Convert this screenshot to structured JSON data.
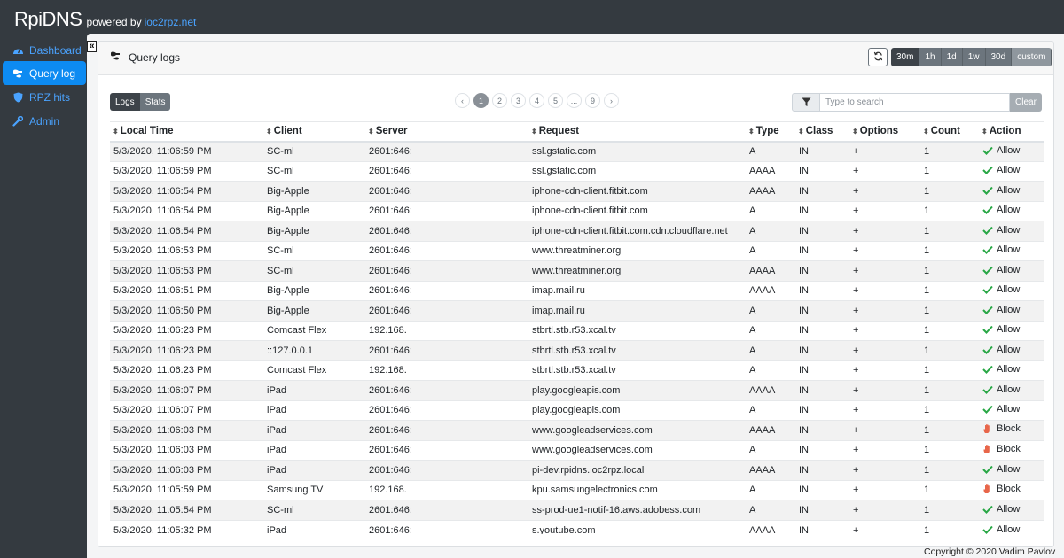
{
  "brand": {
    "name": "RpiDNS",
    "powered_by": "powered by",
    "link_text": "ioc2rpz.net"
  },
  "sidebar": {
    "collapse_label": "«",
    "items": [
      {
        "label": "Dashboard",
        "icon": "dashboard-icon"
      },
      {
        "label": "Query log",
        "icon": "query-log-icon"
      },
      {
        "label": "RPZ hits",
        "icon": "shield-icon"
      },
      {
        "label": "Admin",
        "icon": "wrench-icon"
      }
    ]
  },
  "card": {
    "title": "Query logs"
  },
  "time_range": {
    "options": [
      "30m",
      "1h",
      "1d",
      "1w",
      "30d",
      "custom"
    ],
    "selected": "30m"
  },
  "tabs": {
    "items": [
      "Logs",
      "Stats"
    ],
    "selected": "Logs"
  },
  "pager": {
    "prev": "‹",
    "pages": [
      "1",
      "2",
      "3",
      "4",
      "5",
      "...",
      "9"
    ],
    "next": "›",
    "current": "1"
  },
  "filter": {
    "placeholder": "Type to search",
    "value": "",
    "clear_label": "Clear"
  },
  "table": {
    "columns": [
      "Local Time",
      "Client",
      "Server",
      "Request",
      "Type",
      "Class",
      "Options",
      "Count",
      "Action"
    ],
    "rows": [
      [
        "5/3/2020, 11:06:59 PM",
        "SC-ml",
        "2601:646:",
        "ssl.gstatic.com",
        "A",
        "IN",
        "+",
        "1",
        "Allow"
      ],
      [
        "5/3/2020, 11:06:59 PM",
        "SC-ml",
        "2601:646:",
        "ssl.gstatic.com",
        "AAAA",
        "IN",
        "+",
        "1",
        "Allow"
      ],
      [
        "5/3/2020, 11:06:54 PM",
        "Big-Apple",
        "2601:646:",
        "iphone-cdn-client.fitbit.com",
        "AAAA",
        "IN",
        "+",
        "1",
        "Allow"
      ],
      [
        "5/3/2020, 11:06:54 PM",
        "Big-Apple",
        "2601:646:",
        "iphone-cdn-client.fitbit.com",
        "A",
        "IN",
        "+",
        "1",
        "Allow"
      ],
      [
        "5/3/2020, 11:06:54 PM",
        "Big-Apple",
        "2601:646:",
        "iphone-cdn-client.fitbit.com.cdn.cloudflare.net",
        "A",
        "IN",
        "+",
        "1",
        "Allow"
      ],
      [
        "5/3/2020, 11:06:53 PM",
        "SC-ml",
        "2601:646:",
        "www.threatminer.org",
        "A",
        "IN",
        "+",
        "1",
        "Allow"
      ],
      [
        "5/3/2020, 11:06:53 PM",
        "SC-ml",
        "2601:646:",
        "www.threatminer.org",
        "AAAA",
        "IN",
        "+",
        "1",
        "Allow"
      ],
      [
        "5/3/2020, 11:06:51 PM",
        "Big-Apple",
        "2601:646:",
        "imap.mail.ru",
        "AAAA",
        "IN",
        "+",
        "1",
        "Allow"
      ],
      [
        "5/3/2020, 11:06:50 PM",
        "Big-Apple",
        "2601:646:",
        "imap.mail.ru",
        "A",
        "IN",
        "+",
        "1",
        "Allow"
      ],
      [
        "5/3/2020, 11:06:23 PM",
        "Comcast Flex",
        "192.168.",
        "stbrtl.stb.r53.xcal.tv",
        "A",
        "IN",
        "+",
        "1",
        "Allow"
      ],
      [
        "5/3/2020, 11:06:23 PM",
        "::127.0.0.1",
        "2601:646:",
        "stbrtl.stb.r53.xcal.tv",
        "A",
        "IN",
        "+",
        "1",
        "Allow"
      ],
      [
        "5/3/2020, 11:06:23 PM",
        "Comcast Flex",
        "192.168.",
        "stbrtl.stb.r53.xcal.tv",
        "A",
        "IN",
        "+",
        "1",
        "Allow"
      ],
      [
        "5/3/2020, 11:06:07 PM",
        "iPad",
        "2601:646:",
        "play.googleapis.com",
        "AAAA",
        "IN",
        "+",
        "1",
        "Allow"
      ],
      [
        "5/3/2020, 11:06:07 PM",
        "iPad",
        "2601:646:",
        "play.googleapis.com",
        "A",
        "IN",
        "+",
        "1",
        "Allow"
      ],
      [
        "5/3/2020, 11:06:03 PM",
        "iPad",
        "2601:646:",
        "www.googleadservices.com",
        "AAAA",
        "IN",
        "+",
        "1",
        "Block"
      ],
      [
        "5/3/2020, 11:06:03 PM",
        "iPad",
        "2601:646:",
        "www.googleadservices.com",
        "A",
        "IN",
        "+",
        "1",
        "Block"
      ],
      [
        "5/3/2020, 11:06:03 PM",
        "iPad",
        "2601:646:",
        "pi-dev.rpidns.ioc2rpz.local",
        "AAAA",
        "IN",
        "+",
        "1",
        "Allow"
      ],
      [
        "5/3/2020, 11:05:59 PM",
        "Samsung TV",
        "192.168.",
        "kpu.samsungelectronics.com",
        "A",
        "IN",
        "+",
        "1",
        "Block"
      ],
      [
        "5/3/2020, 11:05:54 PM",
        "SC-ml",
        "2601:646:",
        "ss-prod-ue1-notif-16.aws.adobess.com",
        "A",
        "IN",
        "+",
        "1",
        "Allow"
      ],
      [
        "5/3/2020, 11:05:32 PM",
        "iPad",
        "2601:646:",
        "s.youtube.com",
        "AAAA",
        "IN",
        "+",
        "1",
        "Allow"
      ]
    ]
  },
  "footer": {
    "copyright": "Copyright © 2020 Vadim Pavlov"
  },
  "colors": {
    "accent": "#0d8bf2",
    "allow": "#28a745",
    "block": "#e8664a",
    "dark": "#343a40"
  }
}
